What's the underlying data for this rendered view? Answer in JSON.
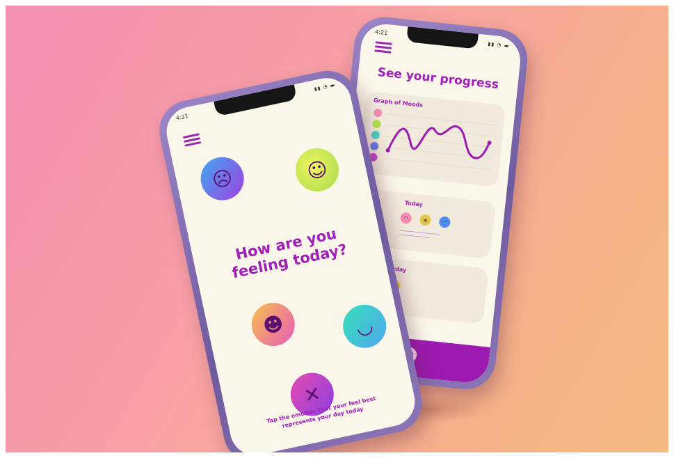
{
  "progress_screen": {
    "status_time": "4:21",
    "title": "See your progress",
    "graph_card": {
      "label": "Graph of Moods"
    },
    "today_card": {
      "label": "Today"
    },
    "yesterday_card": {
      "label": "Yesterday"
    }
  },
  "mood_screen": {
    "status_time": "4:21",
    "question": "How are you feeling today?",
    "hint": "Tap the emotion that your feel best represents your day today"
  },
  "colors": {
    "accent": "#a020b8",
    "screen_bg": "#fbf7ea",
    "nav_bar": "#9c1ab0"
  },
  "icons": [
    "menu-icon",
    "sad-face-icon",
    "happy-face-icon",
    "laughing-face-icon",
    "tired-face-icon",
    "dizzy-face-icon",
    "mood-nav-icon"
  ]
}
